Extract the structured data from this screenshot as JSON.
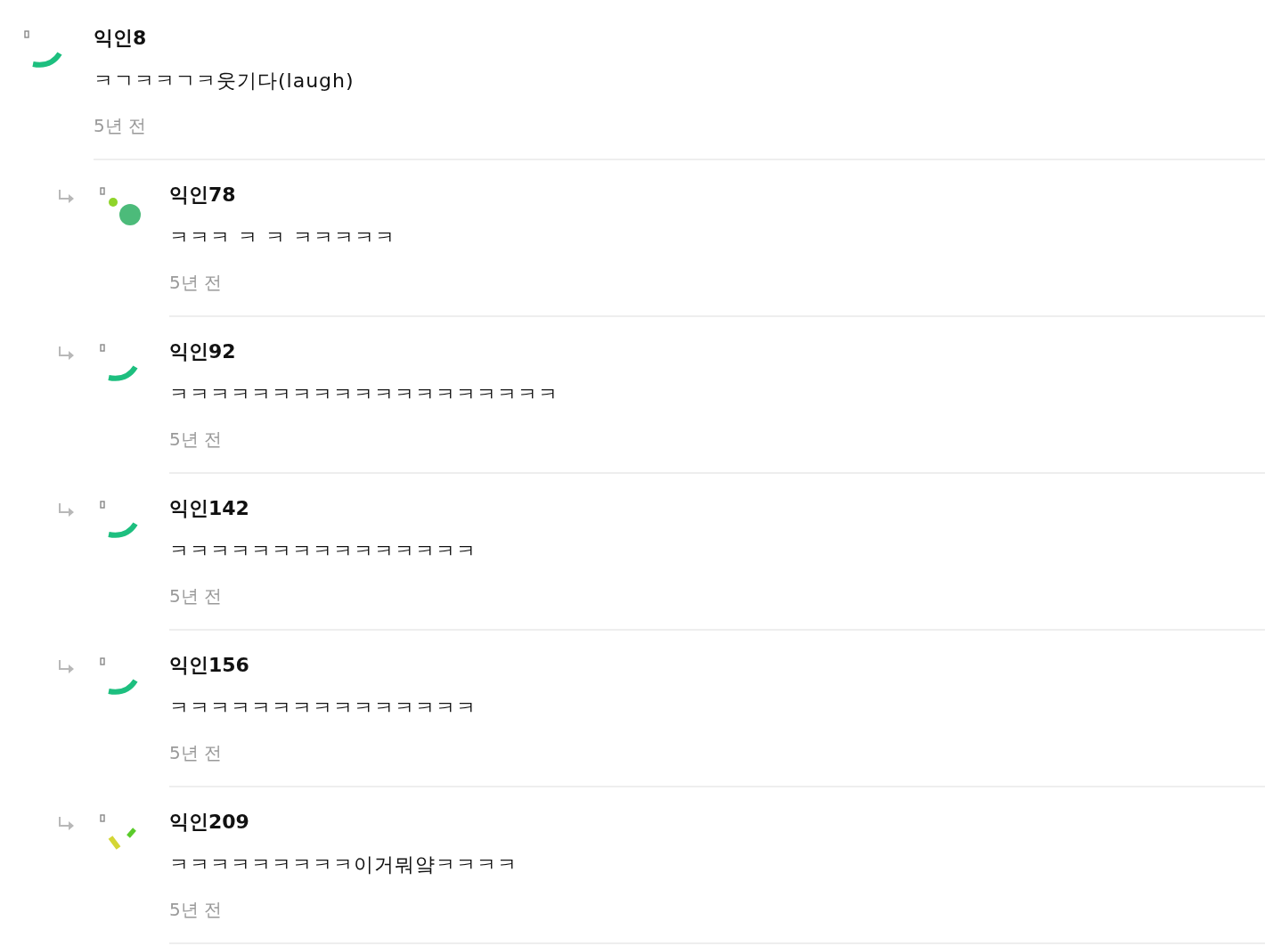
{
  "comments": [
    {
      "author": "익인8",
      "text": "ㅋㄱㅋㅋㄱㅋ웃기다(laugh)",
      "time": "5년 전",
      "reply": false,
      "avatar": {
        "kind": "arc"
      }
    },
    {
      "author": "익인78",
      "text": "ㅋㅋㅋ ㅋ ㅋ ㅋㅋㅋㅋㅋ",
      "time": "5년 전",
      "reply": true,
      "avatar": {
        "kind": "dots"
      }
    },
    {
      "author": "익인92",
      "text": "ㅋㅋㅋㅋㅋㅋㅋㅋㅋㅋㅋㅋㅋㅋㅋㅋㅋㅋㅋ",
      "time": "5년 전",
      "reply": true,
      "avatar": {
        "kind": "arc"
      }
    },
    {
      "author": "익인142",
      "text": "ㅋㅋㅋㅋㅋㅋㅋㅋㅋㅋㅋㅋㅋㅋㅋ",
      "time": "5년 전",
      "reply": true,
      "avatar": {
        "kind": "arc"
      }
    },
    {
      "author": "익인156",
      "text": "ㅋㅋㅋㅋㅋㅋㅋㅋㅋㅋㅋㅋㅋㅋㅋ",
      "time": "5년 전",
      "reply": true,
      "avatar": {
        "kind": "arc"
      }
    },
    {
      "author": "익인209",
      "text": "ㅋㅋㅋㅋㅋㅋㅋㅋㅋ이거뭐얔ㅋㅋㅋㅋ",
      "time": "5년 전",
      "reply": true,
      "avatar": {
        "kind": "ticks"
      }
    }
  ]
}
